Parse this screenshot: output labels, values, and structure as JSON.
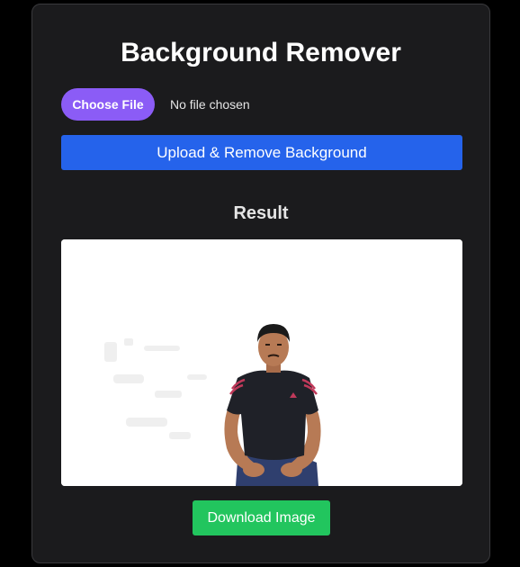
{
  "app": {
    "title": "Background Remover"
  },
  "file_input": {
    "button_label": "Choose File",
    "status_text": "No file chosen"
  },
  "actions": {
    "upload_label": "Upload & Remove Background",
    "download_label": "Download Image"
  },
  "result": {
    "heading": "Result",
    "image_description_icon": "person-photo"
  },
  "colors": {
    "page_background": "#000000",
    "card_background": "#1b1b1d",
    "choose_file_button": "#8b5cf6",
    "upload_button": "#2563eb",
    "download_button": "#22c55e",
    "result_background": "#ffffff"
  }
}
